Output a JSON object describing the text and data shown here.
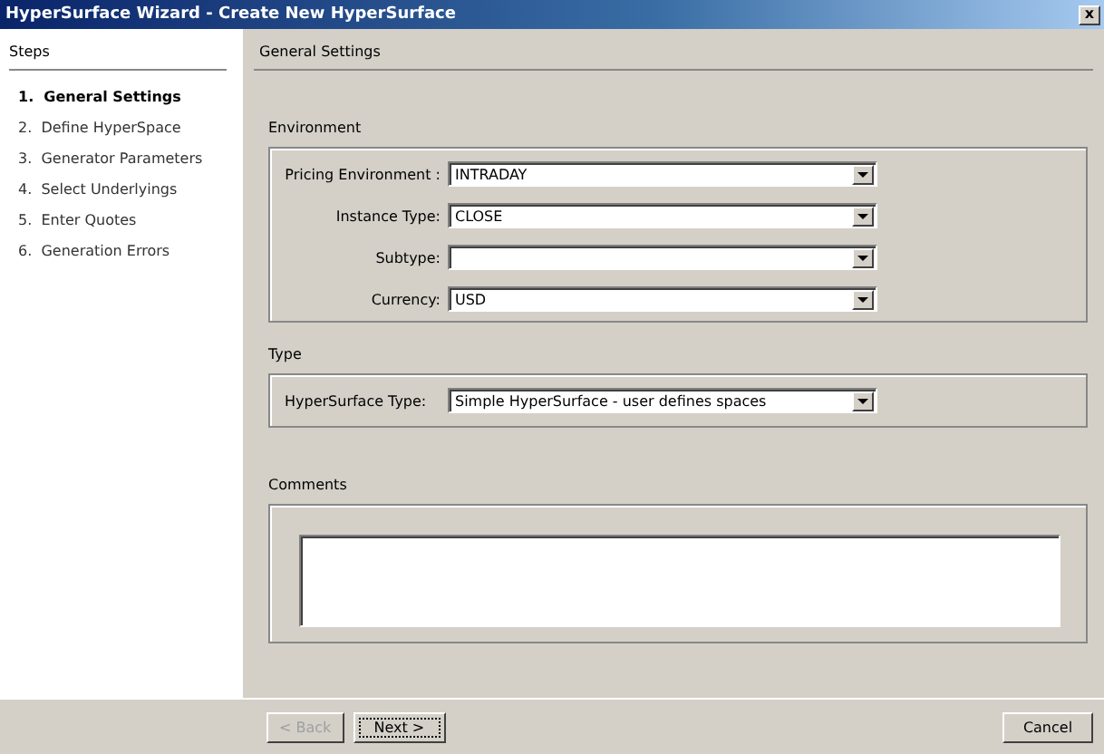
{
  "window": {
    "title": "HyperSurface Wizard - Create New HyperSurface",
    "close": "x"
  },
  "steps": {
    "title": "Steps",
    "items": [
      {
        "label": "1.  General Settings",
        "selected": true
      },
      {
        "label": "2.  Define HyperSpace",
        "selected": false
      },
      {
        "label": "3.  Generator Parameters",
        "selected": false
      },
      {
        "label": "4.  Select Underlyings",
        "selected": false
      },
      {
        "label": "5.  Enter Quotes",
        "selected": false
      },
      {
        "label": "6.  Generation Errors",
        "selected": false
      }
    ]
  },
  "page": {
    "title": "General Settings",
    "environment": {
      "title": "Environment",
      "fields": [
        {
          "label": "Pricing Environment :",
          "value": "INTRADAY"
        },
        {
          "label": "Instance Type:",
          "value": "CLOSE"
        },
        {
          "label": "Subtype:"
        },
        {
          "label": "Currency:",
          "value": "USD"
        }
      ]
    },
    "type": {
      "title": "Type",
      "label": "HyperSurface Type:",
      "value": "Simple HyperSurface - user defines spaces"
    },
    "comments": {
      "title": "Comments"
    }
  },
  "buttons": [
    {
      "label": "< Back",
      "disabled": true,
      "focused": false
    },
    {
      "label": "Next >",
      "disabled": false,
      "focused": true
    },
    {
      "label": "Cancel",
      "disabled": false,
      "focused": false
    }
  ]
}
